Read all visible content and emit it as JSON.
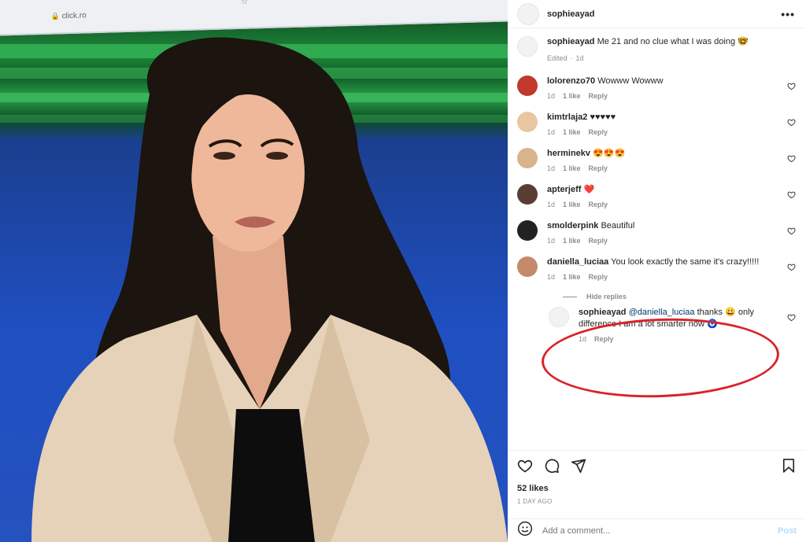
{
  "browser": {
    "url": "click.ro"
  },
  "post": {
    "username": "sophieayad",
    "caption": "Me 21 and no clue what I was doing 🤓",
    "caption_edited": "Edited",
    "caption_time": "1d",
    "likes": "52 likes",
    "timestamp": "1 DAY AGO"
  },
  "comments": [
    {
      "user": "lolorenzo70",
      "text": "Wowww Wowww",
      "time": "1d",
      "likes": "1 like",
      "reply": "Reply",
      "avatar_color": "#c0392b"
    },
    {
      "user": "kimtrlaja2",
      "text": "♥♥♥♥♥",
      "time": "1d",
      "likes": "1 like",
      "reply": "Reply",
      "avatar_color": "#e8c7a0"
    },
    {
      "user": "herminekv",
      "text": "😍😍😍",
      "time": "1d",
      "likes": "1 like",
      "reply": "Reply",
      "avatar_color": "#d9b38c"
    },
    {
      "user": "apterjeff",
      "text": "❤️",
      "time": "1d",
      "likes": "1 like",
      "reply": "Reply",
      "avatar_color": "#5a3d32"
    },
    {
      "user": "smolderpink",
      "text": "Beautiful",
      "time": "1d",
      "likes": "1 like",
      "reply": "Reply",
      "avatar_color": "#222222"
    },
    {
      "user": "daniella_luciaa",
      "text": "You look exactly the same it's crazy!!!!!",
      "time": "1d",
      "likes": "1 like",
      "reply": "Reply",
      "avatar_color": "#c48a6a"
    }
  ],
  "hide_replies": "Hide replies",
  "reply": {
    "user": "sophieayad",
    "mention": "@daniella_luciaa",
    "text": "thanks 😀 only difference I am a lot smarter now 🧿",
    "time": "1d",
    "reply": "Reply"
  },
  "add_comment": {
    "placeholder": "Add a comment...",
    "post": "Post"
  },
  "colors": {
    "highlight": "#d8232a",
    "accent": "#0095f6"
  }
}
